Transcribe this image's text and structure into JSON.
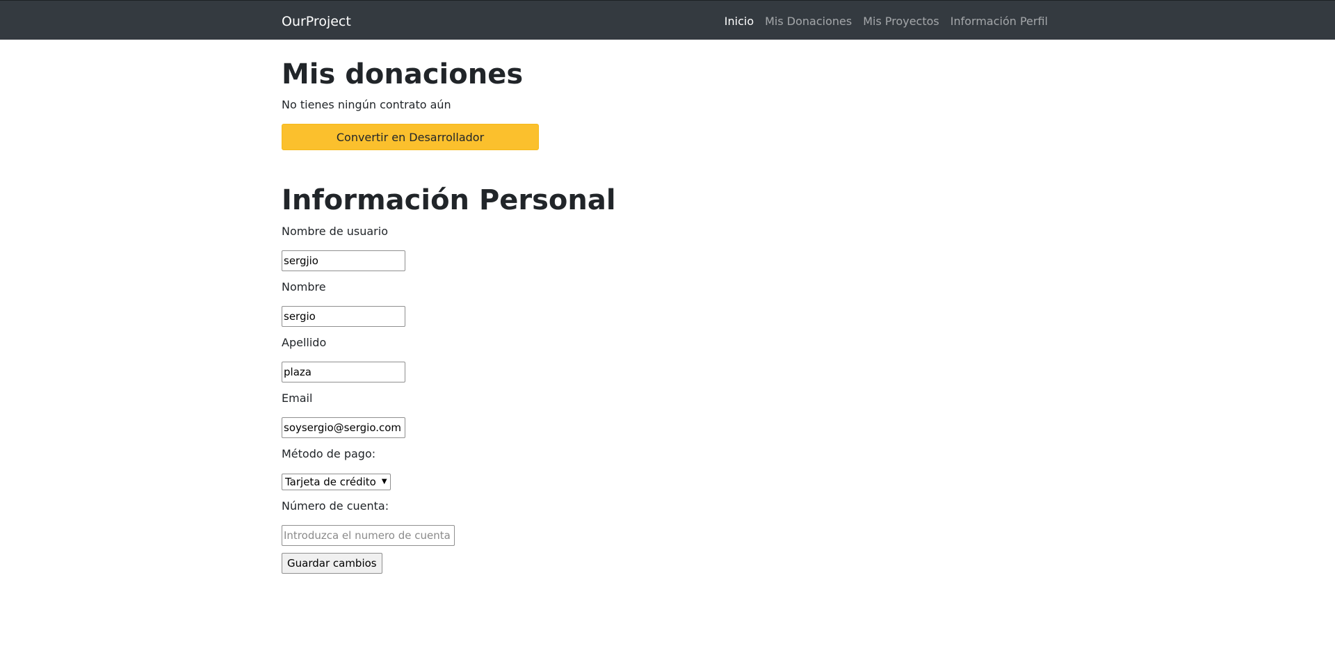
{
  "navbar": {
    "brand": "OurProject",
    "links": [
      {
        "label": "Inicio",
        "active": true
      },
      {
        "label": "Mis Donaciones",
        "active": false
      },
      {
        "label": "Mis Proyectos",
        "active": false
      },
      {
        "label": "Información Perfil",
        "active": false
      }
    ]
  },
  "donations": {
    "title": "Mis donaciones",
    "empty_text": "No tienes ningún contrato aún",
    "convert_button": "Convertir en Desarrollador"
  },
  "personal": {
    "title": "Información Personal",
    "username_label": "Nombre de usuario",
    "username_value": "sergjio",
    "name_label": "Nombre",
    "name_value": "sergio",
    "surname_label": "Apellido",
    "surname_value": "plaza",
    "email_label": "Email",
    "email_value": "soysergio@sergio.com",
    "payment_label": "Método de pago:",
    "payment_selected": "Tarjeta de crédito",
    "account_label": "Número de cuenta:",
    "account_placeholder": "Introduzca el numero de cuenta",
    "save_button": "Guardar cambios"
  },
  "colors": {
    "navbar_bg": "#343a40",
    "accent_button": "#fbc02d"
  }
}
